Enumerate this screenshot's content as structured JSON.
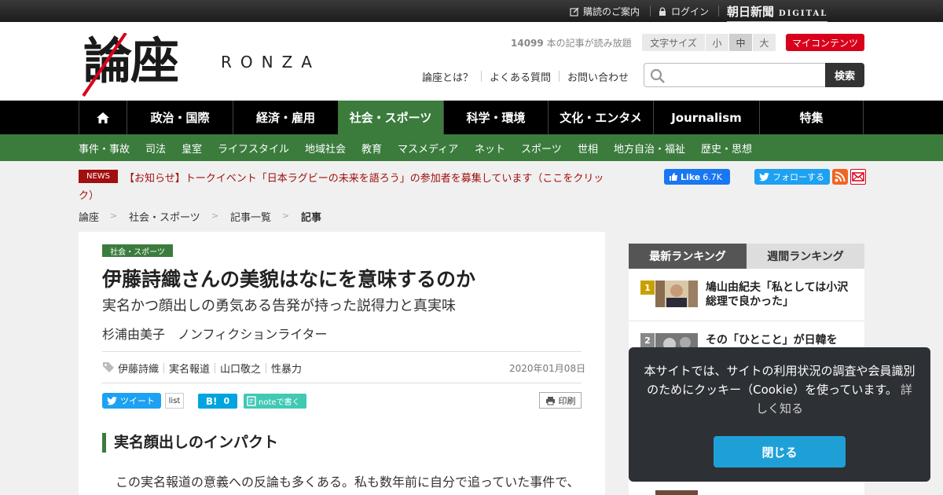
{
  "topbar": {
    "subscribe_label": "購読のご案内",
    "login_label": "ログイン",
    "brand_main": "朝日新聞",
    "brand_sub": "DIGITAL"
  },
  "header": {
    "logo_text": "論座",
    "logo_latin": "RONZA",
    "read_count": "14099",
    "read_count_suffix": "本の記事が読み放題",
    "font_size_label": "文字サイズ",
    "font_sizes": [
      "小",
      "中",
      "大"
    ],
    "font_size_selected": "中",
    "my_contents_label": "マイコンテンツ",
    "links": [
      "論座とは？",
      "よくある質問",
      "お問い合わせ"
    ],
    "search_placeholder": "",
    "search_button_label": "検索"
  },
  "main_nav": {
    "items": [
      "政治・国際",
      "経済・雇用",
      "社会・スポーツ",
      "科学・環境",
      "文化・エンタメ",
      "Journalism",
      "特集"
    ],
    "active": "社会・スポーツ"
  },
  "sub_nav": {
    "items": [
      "事件・事故",
      "司法",
      "皇室",
      "ライフスタイル",
      "地域社会",
      "教育",
      "マスメディア",
      "ネット",
      "スポーツ",
      "世相",
      "地方自治・福祉",
      "歴史・思想"
    ]
  },
  "news": {
    "badge": "NEWS",
    "text": "【お知らせ】トークイベント「日本ラグビーの未来を語ろう」の参加者を募集しています（ここをクリック）"
  },
  "social_header": {
    "fb_like_label": "Like",
    "fb_like_count": "6.7K",
    "twitter_follow_label": "フォローする"
  },
  "breadcrumb": {
    "items": [
      "論座",
      "社会・スポーツ",
      "記事一覧",
      "記事"
    ],
    "separator": ">"
  },
  "article": {
    "category": "社会・スポーツ",
    "title": "伊藤詩織さんの美貌はなにを意味するのか",
    "subtitle": "実名かつ顔出しの勇気ある告発が持った説得力と真実味",
    "author": "杉浦由美子　ノンフィクションライター",
    "tags": [
      "伊藤詩織",
      "実名報道",
      "山口敬之",
      "性暴力"
    ],
    "date": "2020年01月08日",
    "share": {
      "tweet_label": "ツイート",
      "list_label": "list",
      "hatena_count": "0",
      "note_label": "noteで書く",
      "print_label": "印刷"
    },
    "section_heading": "実名顔出しのインパクト",
    "body_first_line": "この実名報道の意義への反論も多くある。私も数年前に自分で追っていた事件で、"
  },
  "ranking": {
    "tabs": [
      "最新ランキング",
      "週間ランキング"
    ],
    "active_tab": "最新ランキング",
    "items": [
      {
        "rank": "1",
        "title": "鳩山由紀夫「私としては小沢総理で良かった」"
      },
      {
        "rank": "2",
        "title": "その「ひとこと」が日韓を"
      }
    ]
  },
  "cookie": {
    "text": "本サイトでは、サイトの利用状況の調査や会員識別のためにクッキー（Cookie）を使っています。",
    "more_link": "詳しく知る",
    "close_label": "閉じる"
  },
  "colors": {
    "green": "#3b7c3d",
    "red": "#d9001b",
    "news_red": "#a10f0f",
    "cookie_bg": "#2d3035",
    "cookie_button": "#1ea0d7"
  }
}
